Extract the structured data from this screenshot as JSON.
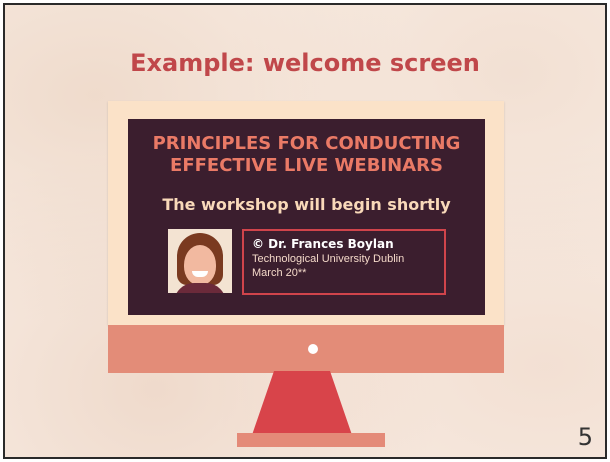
{
  "slide": {
    "title": "Example: welcome screen",
    "page_number": "5"
  },
  "screen": {
    "heading_line1": "PRINCIPLES FOR CONDUCTING",
    "heading_line2": "EFFECTIVE LIVE WEBINARS",
    "subheading": "The workshop will begin shortly",
    "presenter": {
      "name": "© Dr. Frances Boylan",
      "institution": "Technological University Dublin",
      "date": "March 20**"
    }
  },
  "colors": {
    "accent": "#c0474a",
    "screen_background": "#3b1e2e",
    "heading": "#ea7a66",
    "frame": "#fbe2c8",
    "stand": "#d8444a"
  }
}
